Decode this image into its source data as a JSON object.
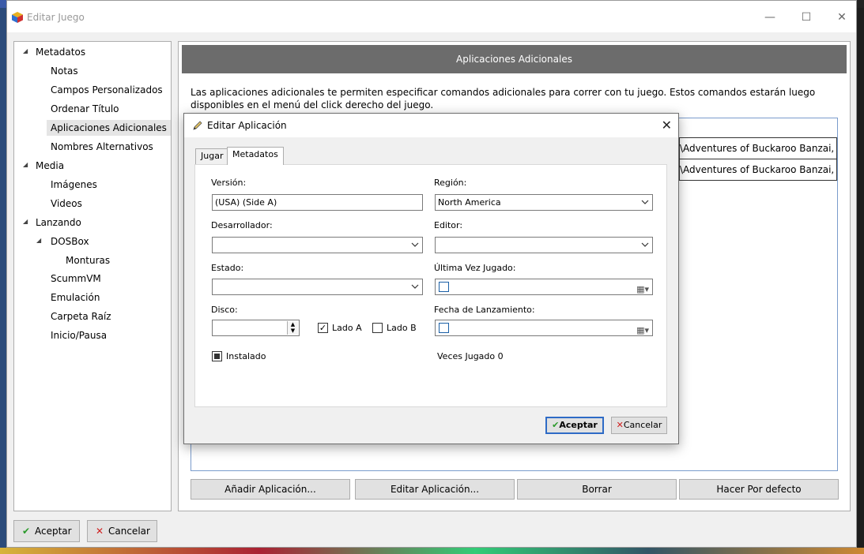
{
  "window": {
    "title": "Editar Juego",
    "minimize_glyph": "—",
    "maximize_glyph": "☐",
    "close_glyph": "✕"
  },
  "tree": [
    {
      "label": "Metadatos",
      "level": 0,
      "expanded": true
    },
    {
      "label": "Notas",
      "level": 1
    },
    {
      "label": "Campos Personalizados",
      "level": 1
    },
    {
      "label": "Ordenar Título",
      "level": 1
    },
    {
      "label": "Aplicaciones Adicionales",
      "level": 1,
      "selected": true
    },
    {
      "label": "Nombres Alternativos",
      "level": 1
    },
    {
      "label": "Media",
      "level": 0,
      "expanded": true
    },
    {
      "label": "Imágenes",
      "level": 1
    },
    {
      "label": "Videos",
      "level": 1
    },
    {
      "label": "Lanzando",
      "level": 0,
      "expanded": true
    },
    {
      "label": "DOSBox",
      "level": 1,
      "expanded": true
    },
    {
      "label": "Monturas",
      "level": 2
    },
    {
      "label": "ScummVM",
      "level": 1
    },
    {
      "label": "Emulación",
      "level": 1
    },
    {
      "label": "Carpeta Raíz",
      "level": 1
    },
    {
      "label": "Inicio/Pausa",
      "level": 1
    }
  ],
  "panel": {
    "header": "Aplicaciones Adicionales",
    "description": "Las aplicaciones adicionales te permiten especificar comandos adicionales para correr con tu juego. Estos comandos estarán luego disponibles en el menú del click derecho del juego.",
    "rows": [
      "\\Adventures of Buckaroo Banzai, The",
      "\\Adventures of Buckaroo Banzai, The"
    ],
    "buttons": {
      "add": "Añadir Aplicación...",
      "edit": "Editar Aplicación...",
      "delete": "Borrar",
      "default": "Hacer Por defecto"
    }
  },
  "footer": {
    "accept": "Aceptar",
    "cancel": "Cancelar"
  },
  "dialog": {
    "title": "Editar Aplicación",
    "close_glyph": "✕",
    "tabs": {
      "play": "Jugar",
      "metadata": "Metadatos"
    },
    "fields": {
      "version_label": "Versión:",
      "version_value": "(USA) (Side A)",
      "region_label": "Región:",
      "region_value": "North America",
      "developer_label": "Desarrollador:",
      "developer_value": "",
      "publisher_label": "Editor:",
      "publisher_value": "",
      "status_label": "Estado:",
      "status_value": "",
      "last_played_label": "Última Vez Jugado:",
      "disc_label": "Disco:",
      "disc_value": "",
      "side_a_label": "Lado A",
      "side_a_checked": true,
      "side_b_label": "Lado B",
      "side_b_checked": false,
      "release_date_label": "Fecha de Lanzamiento:",
      "installed_label": "Instalado",
      "installed_state": "indeterminate",
      "times_played": "Veces Jugado 0"
    },
    "buttons": {
      "accept": "Aceptar",
      "cancel": "Cancelar"
    }
  },
  "colors": {
    "accent": "#2e6bc6",
    "header_bg": "#6c6c6c",
    "accept_check": "#2a9a2a",
    "cancel_x": "#d02020"
  }
}
